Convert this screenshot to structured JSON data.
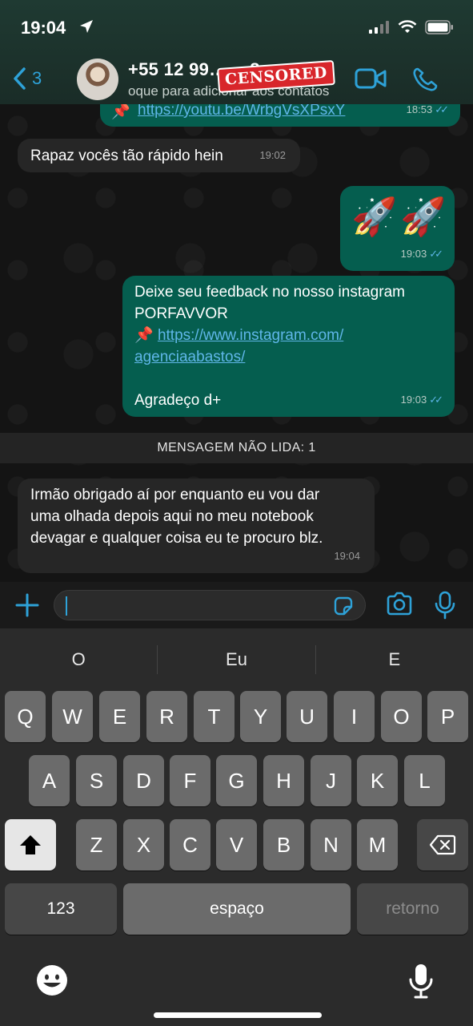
{
  "status": {
    "time": "19:04"
  },
  "header": {
    "back_count": "3",
    "contact_name": "+55 12 99… …8",
    "subtitle": "oque para adicionar aos contatos",
    "censor_label": "CENSORED"
  },
  "messages": [
    {
      "dir": "out",
      "link": "https://youtu.be/WrbgVsXPsxY",
      "time": "18:53"
    },
    {
      "dir": "in",
      "text": "Rapaz vocês tão rápido hein",
      "time": "19:02"
    },
    {
      "dir": "out",
      "text": "🚀🚀",
      "time": "19:03"
    },
    {
      "dir": "out",
      "line1": "Deixe seu feedback no nosso instagram",
      "line2": "PORFAVVOR",
      "pin": "📌",
      "link1": "https://www.instagram.com/",
      "link2": "agenciaabastos/",
      "line3": "Agradeço d+",
      "time": "19:03"
    },
    {
      "dir": "in",
      "line1": "Irmão obrigado aí por enquanto eu vou dar",
      "line2": "uma olhada depois aqui no meu notebook",
      "line3": "devagar e qualquer coisa eu te procuro blz.",
      "time": "19:04"
    }
  ],
  "unread_label": "MENSAGEM NÃO LIDA: 1",
  "input": {
    "value": ""
  },
  "keyboard": {
    "suggestions": [
      "O",
      "Eu",
      "E"
    ],
    "row1": [
      "Q",
      "W",
      "E",
      "R",
      "T",
      "Y",
      "U",
      "I",
      "O",
      "P"
    ],
    "row2": [
      "A",
      "S",
      "D",
      "F",
      "G",
      "H",
      "J",
      "K",
      "L"
    ],
    "row3": [
      "Z",
      "X",
      "C",
      "V",
      "B",
      "N",
      "M"
    ],
    "numbers_key": "123",
    "space_key": "espaço",
    "return_key": "retorno"
  },
  "colors": {
    "accent": "#2ea2d8",
    "outgoing_bubble": "#055e4f",
    "incoming_bubble": "#262626",
    "read_ticks": "#5cb5e6"
  }
}
